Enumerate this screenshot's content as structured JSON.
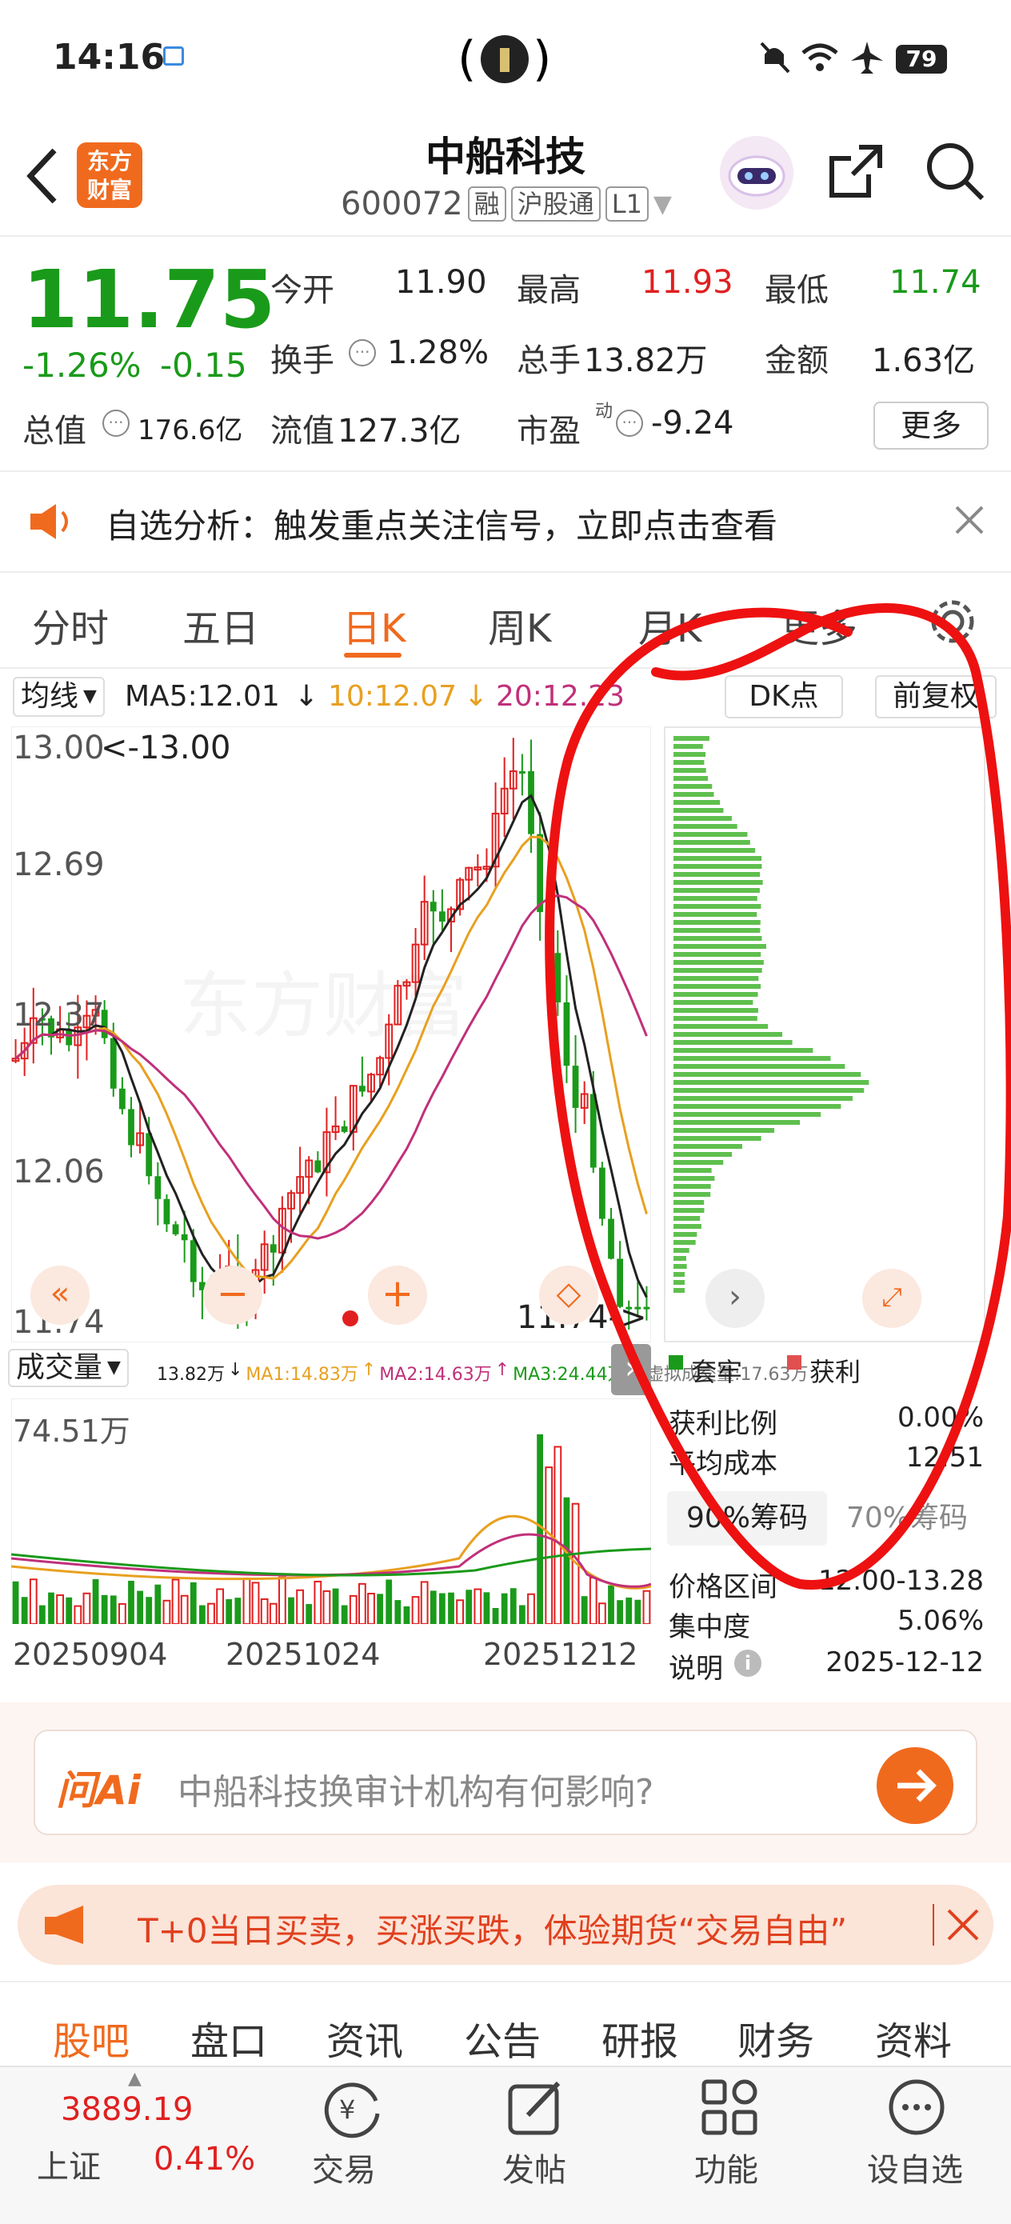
{
  "status_bar": {
    "time": "14:16",
    "battery": "79"
  },
  "header": {
    "logo_text": [
      "东方",
      "财富"
    ],
    "title": "中船科技",
    "code": "600072",
    "tags": [
      "融",
      "沪股通",
      "L1"
    ]
  },
  "quote": {
    "price": "11.75",
    "change_pct": "-1.26%",
    "change_abs": "-0.15",
    "open_label": "今开",
    "open": "11.90",
    "high_label": "最高",
    "high": "11.93",
    "low_label": "最低",
    "low": "11.74",
    "turnover_label": "换手",
    "turnover": "1.28%",
    "volume_label": "总手",
    "volume": "13.82万",
    "amount_label": "金额",
    "amount": "1.63亿",
    "mktcap_label": "总值",
    "mktcap": "176.6亿",
    "float_label": "流值",
    "float_cap": "127.3亿",
    "pe_label": "市盈",
    "pe_sup": "动",
    "pe": "-9.24",
    "more_button": "更多"
  },
  "notice": {
    "text": "自选分析：触发重点关注信号，立即点击查看"
  },
  "chart_tabs": {
    "tabs": [
      "分时",
      "五日",
      "日K",
      "周K",
      "月K",
      "更多"
    ],
    "active": "日K"
  },
  "ma_bar": {
    "selector": "均线",
    "ma5": "MA5:12.01",
    "ma10": "10:12.07",
    "ma20": "20:12.23",
    "dk_button": "DK点",
    "adjust_button": "前复权"
  },
  "kline": {
    "y_labels": [
      "13.00",
      "12.69",
      "12.37",
      "12.06",
      "11.74"
    ],
    "max_marker": "<-13.00",
    "min_marker": "11.74->"
  },
  "volume_bar": {
    "selector": "成交量",
    "vol": "13.82万",
    "ma1": "MA1:14.83万",
    "ma2": "MA2:14.63万",
    "ma3": "MA3:24.44万",
    "virtual": "虚拟成交量:17.63万",
    "y_label": "74.51万",
    "dates": [
      "20250904",
      "20251024",
      "20251212"
    ]
  },
  "chips": {
    "legend_trapped": "套牢",
    "legend_profit": "获利",
    "profit_ratio_label": "获利比例",
    "profit_ratio": "0.00%",
    "avg_cost_label": "平均成本",
    "avg_cost": "12.51",
    "tab_90": "90%筹码",
    "tab_70": "70%筹码",
    "range_label": "价格区间",
    "range": "12.00-13.28",
    "concentration_label": "集中度",
    "concentration": "5.06%",
    "note_label": "说明",
    "date": "2025-12-12"
  },
  "ask_ai": {
    "brand": "问Ai",
    "placeholder": "中船科技换审计机构有何影响?"
  },
  "promo": {
    "text": "T+0当日买卖，买涨买跌，体验期货“交易自由”"
  },
  "section_tabs": [
    "股吧",
    "盘口",
    "资讯",
    "公告",
    "研报",
    "财务",
    "资料"
  ],
  "bottom_nav": {
    "index_value": "3889.19",
    "index_name": "上证",
    "index_change": "0.41%",
    "items": [
      "交易",
      "发帖",
      "功能",
      "设自选"
    ]
  },
  "colors": {
    "up": "#e02020",
    "down": "#1a9a1a",
    "accent": "#f06a1e",
    "ma5": "#222222",
    "ma10": "#e8a020",
    "ma20": "#c0307a"
  }
}
